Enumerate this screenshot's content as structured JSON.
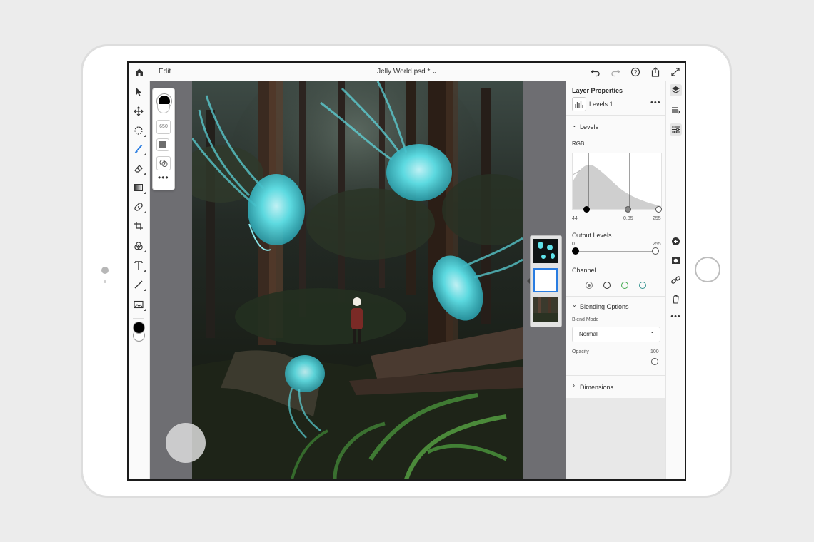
{
  "app": {
    "menu_label": "Edit",
    "document_title": "Jelly World.psd *",
    "icons": [
      "home-icon",
      "undo-icon",
      "redo-icon",
      "help-icon",
      "share-icon",
      "fullscreen-icon"
    ]
  },
  "toolbar": {
    "tools": [
      "select-tool",
      "move-tool",
      "lasso-tool",
      "brush-tool",
      "eraser-tool",
      "gradient-tool",
      "healing-tool",
      "crop-tool",
      "adjust-tool",
      "type-tool",
      "line-tool",
      "image-tool"
    ],
    "foreground_color": "#000000",
    "background_color": "#ffffff"
  },
  "brush_options": {
    "size_label": "650"
  },
  "layer_properties": {
    "title": "Layer Properties",
    "layer_name": "Levels 1",
    "levels_section": "Levels",
    "channel_label": "RGB",
    "input_min": "44",
    "input_mid": "0.85",
    "input_max": "255",
    "output_levels_label": "Output Levels",
    "output_min": "0",
    "output_max": "255",
    "channel_section_label": "Channel",
    "blending_section": "Blending Options",
    "blend_mode_label": "Blend Mode",
    "blend_mode_value": "Normal",
    "opacity_label": "Opacity",
    "opacity_value": "100",
    "dimensions_section": "Dimensions"
  },
  "colors": {
    "canvas_bg": "#6e6e72",
    "jellyfish": "#5fe3ea",
    "channel_green": "#3ea84a",
    "channel_blue": "#2f8f8c"
  }
}
